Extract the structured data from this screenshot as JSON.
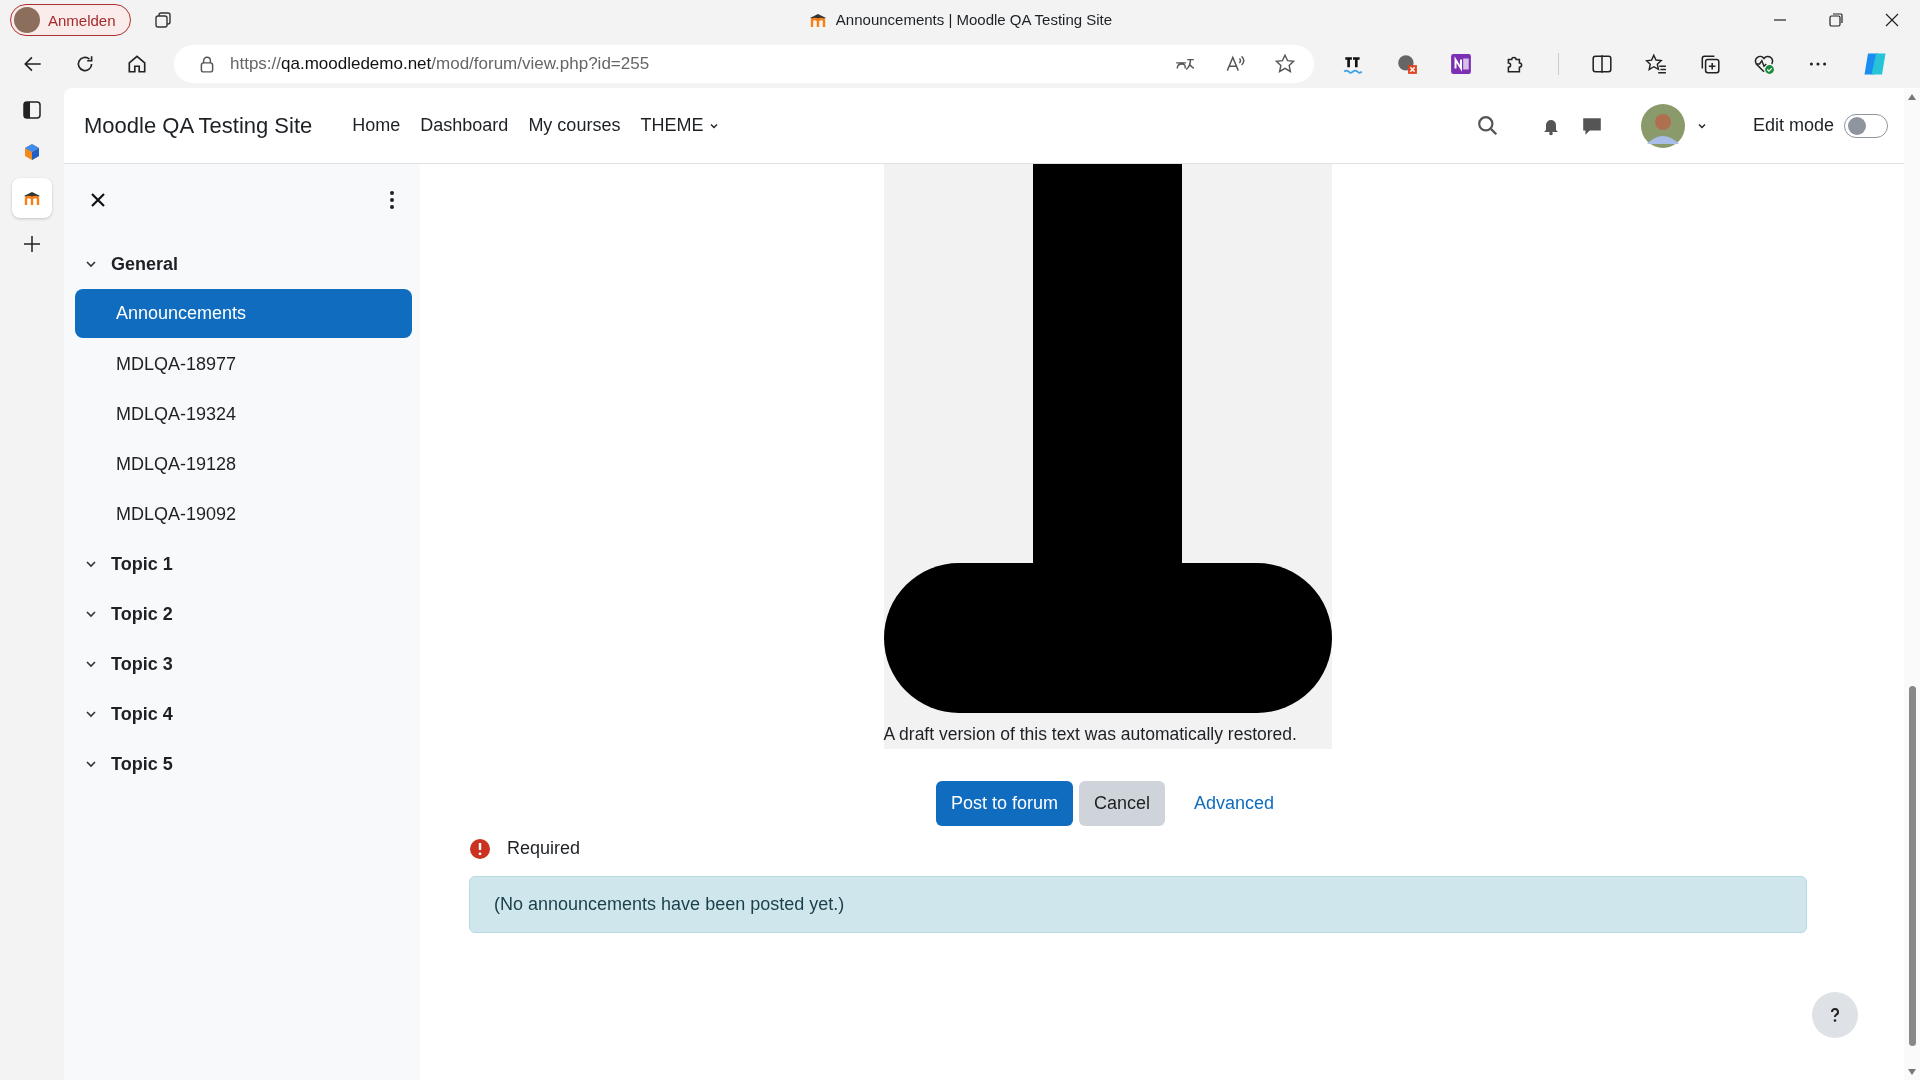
{
  "browser": {
    "profile_button": "Anmelden",
    "tab_title": "Announcements | Moodle QA Testing Site",
    "url": {
      "scheme": "https://",
      "host": "qa.moodledemo.net",
      "path": "/mod/forum/view.php?id=255"
    }
  },
  "site": {
    "name": "Moodle QA Testing Site",
    "nav": [
      {
        "label": "Home",
        "dropdown": false
      },
      {
        "label": "Dashboard",
        "dropdown": false
      },
      {
        "label": "My courses",
        "dropdown": false
      },
      {
        "label": "THEME",
        "dropdown": true
      }
    ],
    "edit_mode": {
      "label": "Edit mode",
      "on": false
    }
  },
  "drawer": {
    "sections": [
      {
        "label": "General",
        "items": [
          {
            "label": "Announcements",
            "selected": true
          },
          {
            "label": "MDLQA-18977",
            "selected": false
          },
          {
            "label": "MDLQA-19324",
            "selected": false
          },
          {
            "label": "MDLQA-19128",
            "selected": false
          },
          {
            "label": "MDLQA-19092",
            "selected": false
          }
        ]
      },
      {
        "label": "Topic 1"
      },
      {
        "label": "Topic 2"
      },
      {
        "label": "Topic 3"
      },
      {
        "label": "Topic 4"
      },
      {
        "label": "Topic 5"
      }
    ]
  },
  "content": {
    "caption": "A draft version of this text was automatically restored.",
    "buttons": [
      {
        "label": "Post to forum",
        "kind": "primary"
      },
      {
        "label": "Cancel",
        "kind": "secondary"
      },
      {
        "label": "Advanced",
        "kind": "link"
      }
    ],
    "required_label": "Required",
    "alert": "(No announcements have been posted yet.)"
  }
}
